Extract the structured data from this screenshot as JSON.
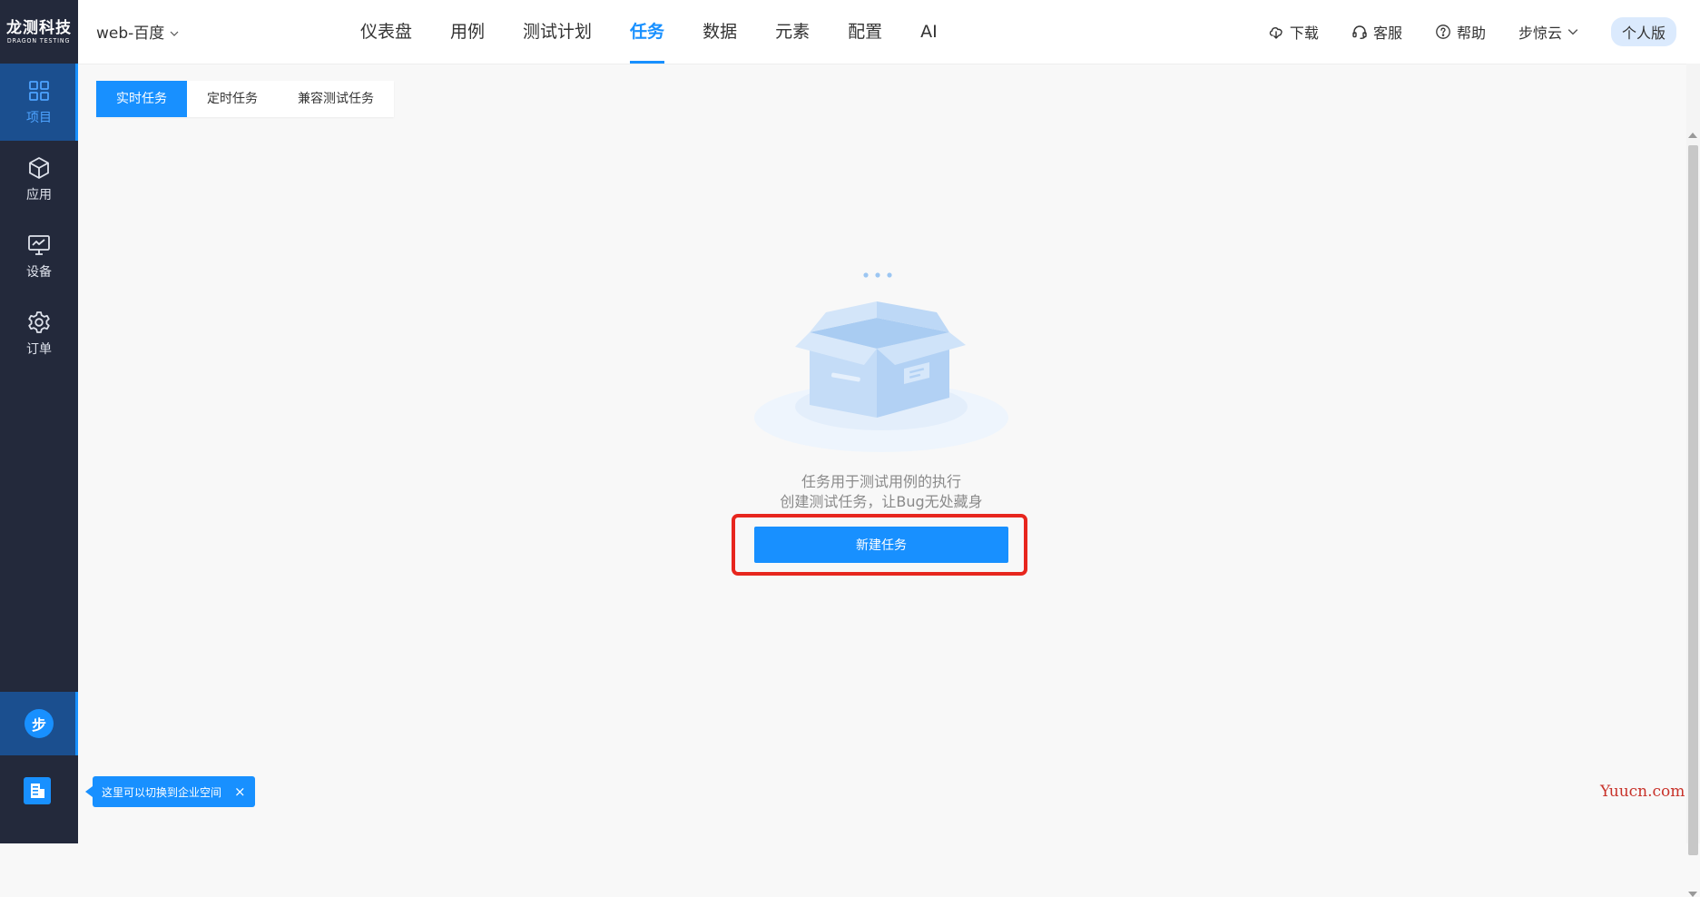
{
  "app": {
    "logo_cn": "龙测科技",
    "logo_en": "DRAGON TESTING",
    "accent_color": "#1890ff",
    "sidebar_bg": "#23293b"
  },
  "sidebar": {
    "items": [
      {
        "label": "项目",
        "icon": "grid-icon",
        "active": true
      },
      {
        "label": "应用",
        "icon": "cube-icon",
        "active": false
      },
      {
        "label": "设备",
        "icon": "monitor-icon",
        "active": false
      },
      {
        "label": "订单",
        "icon": "gear-icon",
        "active": false
      }
    ],
    "user_avatar": "步",
    "tooltip": "这里可以切换到企业空间",
    "tooltip_close": "×"
  },
  "header": {
    "project": "web-百度",
    "nav": [
      {
        "label": "仪表盘",
        "active": false
      },
      {
        "label": "用例",
        "active": false
      },
      {
        "label": "测试计划",
        "active": false
      },
      {
        "label": "任务",
        "active": true
      },
      {
        "label": "数据",
        "active": false
      },
      {
        "label": "元素",
        "active": false
      },
      {
        "label": "配置",
        "active": false
      },
      {
        "label": "AI",
        "active": false
      }
    ],
    "download": "下载",
    "service": "客服",
    "help": "帮助",
    "user": "步惊云",
    "version": "个人版"
  },
  "tabs": [
    {
      "label": "实时任务",
      "active": true
    },
    {
      "label": "定时任务",
      "active": false
    },
    {
      "label": "兼容测试任务",
      "active": false
    }
  ],
  "empty": {
    "line1": "任务用于测试用例的执行",
    "line2": "创建测试任务，让Bug无处藏身",
    "button": "新建任务"
  },
  "watermark": "Yuucn.com"
}
